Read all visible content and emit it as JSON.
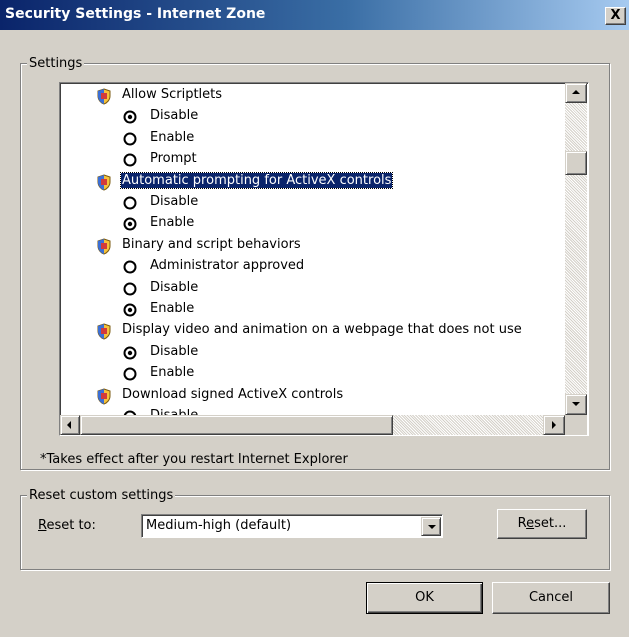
{
  "window": {
    "title": "Security Settings - Internet Zone",
    "close_label": "X"
  },
  "settings_group": {
    "legend": "Settings",
    "items": [
      {
        "type": "header",
        "label": "Allow Scriptlets",
        "icon": "settings-shield-icon",
        "selected": false
      },
      {
        "type": "option",
        "label": "Disable",
        "checked": true
      },
      {
        "type": "option",
        "label": "Enable",
        "checked": false
      },
      {
        "type": "option",
        "label": "Prompt",
        "checked": false
      },
      {
        "type": "header",
        "label": "Automatic prompting for ActiveX controls",
        "icon": "settings-shield-icon",
        "selected": true
      },
      {
        "type": "option",
        "label": "Disable",
        "checked": false
      },
      {
        "type": "option",
        "label": "Enable",
        "checked": true
      },
      {
        "type": "header",
        "label": "Binary and script behaviors",
        "icon": "settings-shield-icon",
        "selected": false
      },
      {
        "type": "option",
        "label": "Administrator approved",
        "checked": false
      },
      {
        "type": "option",
        "label": "Disable",
        "checked": false
      },
      {
        "type": "option",
        "label": "Enable",
        "checked": true
      },
      {
        "type": "header",
        "label": "Display video and animation on a webpage that does not use",
        "icon": "settings-shield-icon",
        "selected": false
      },
      {
        "type": "option",
        "label": "Disable",
        "checked": true
      },
      {
        "type": "option",
        "label": "Enable",
        "checked": false
      },
      {
        "type": "header",
        "label": "Download signed ActiveX controls",
        "icon": "settings-shield-icon",
        "selected": false
      },
      {
        "type": "option",
        "label": "Disable",
        "checked": false
      }
    ],
    "note": "*Takes effect after you restart Internet Explorer"
  },
  "reset_group": {
    "legend": "Reset custom settings",
    "reset_to_label_accel": "R",
    "reset_to_label_rest": "eset to:",
    "reset_to_value": "Medium-high (default)",
    "reset_button_pre": "R",
    "reset_button_accel": "e",
    "reset_button_post": "set..."
  },
  "buttons": {
    "ok": "OK",
    "cancel": "Cancel"
  },
  "colors": {
    "dialog_bg": "#d4d0c8",
    "title_bar_start": "#0a246a",
    "title_bar_end": "#a6caf0",
    "selection_bg": "#0a246a"
  }
}
